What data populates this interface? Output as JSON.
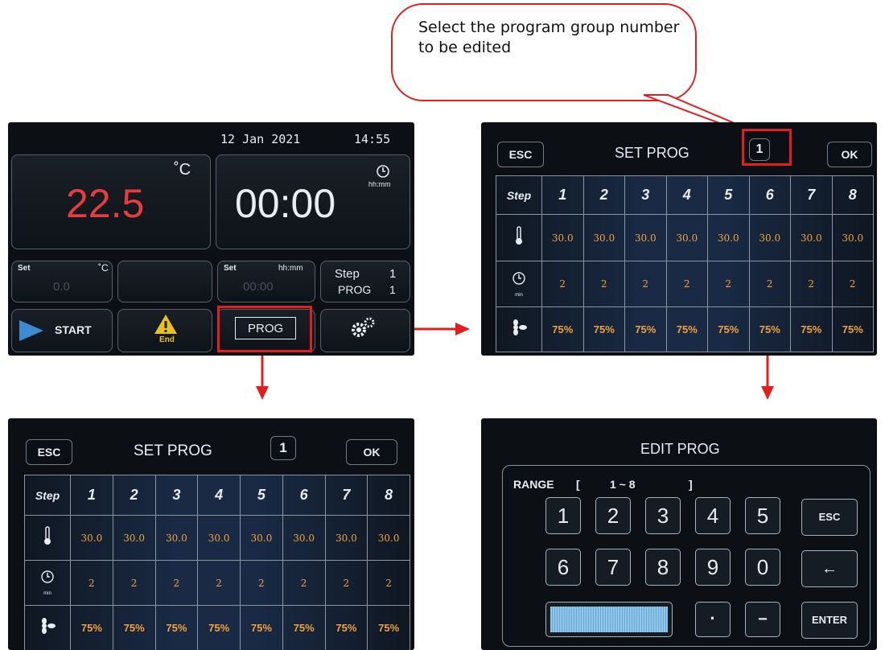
{
  "callout": {
    "text": "Select the program group number to be edited"
  },
  "main_screen": {
    "date": "12 Jan 2021",
    "time": "14:55",
    "temp_value": "22.5",
    "temp_unit": "˚C",
    "timer_value": "00:00",
    "timer_unit": "hh:mm",
    "set_temp_label": "Set",
    "set_temp_unit": "˚C",
    "set_temp_value": "0.0",
    "set_time_label": "Set",
    "set_time_unit": "hh:mm",
    "set_time_value": "00:00",
    "step_label": "Step",
    "step_value": "1",
    "prog_label": "PROG",
    "prog_value": "1",
    "start_label": "START",
    "end_label": "End",
    "prog_button_label": "PROG"
  },
  "set_prog": {
    "esc_label": "ESC",
    "title": "SET PROG",
    "group_number": "1",
    "ok_label": "OK",
    "step_header": "Step",
    "steps": [
      "1",
      "2",
      "3",
      "4",
      "5",
      "6",
      "7",
      "8"
    ],
    "temps": [
      "30.0",
      "30.0",
      "30.0",
      "30.0",
      "30.0",
      "30.0",
      "30.0",
      "30.0"
    ],
    "times": [
      "2",
      "2",
      "2",
      "2",
      "2",
      "2",
      "2",
      "2"
    ],
    "time_unit": "min",
    "fans": [
      "75%",
      "75%",
      "75%",
      "75%",
      "75%",
      "75%",
      "75%",
      "75%"
    ]
  },
  "edit_prog": {
    "title": "EDIT PROG",
    "range_label": "RANGE",
    "range_open": "[",
    "range_value": "1 ~ 8",
    "range_close": "]",
    "keys_row1": [
      "1",
      "2",
      "3",
      "4",
      "5"
    ],
    "keys_row2": [
      "6",
      "7",
      "8",
      "9",
      "0"
    ],
    "esc_label": "ESC",
    "back_label": "←",
    "dot_label": "·",
    "minus_label": "−",
    "enter_label": "ENTER"
  },
  "colors": {
    "accent": "#e02020",
    "temp_red": "#e43d3d",
    "value_orange": "#f0a33a"
  }
}
